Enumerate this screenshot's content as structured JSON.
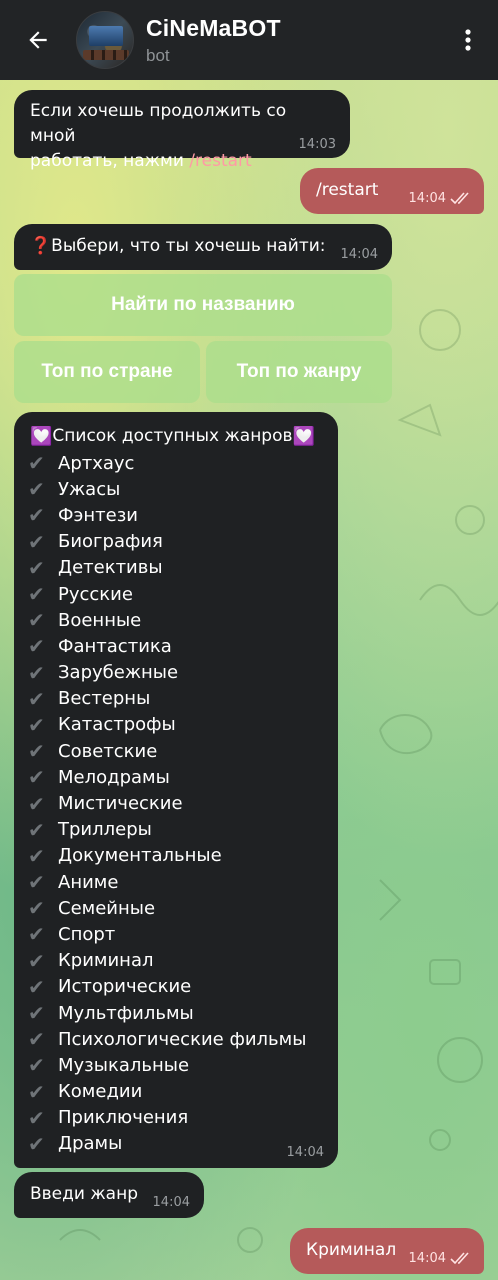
{
  "header": {
    "title": "CiNeMaBOT",
    "subtitle": "bot"
  },
  "messages": {
    "m1": {
      "text_part1": "Если хочешь продолжить со мной",
      "text_part2": "работать, нажми ",
      "command": "/restart",
      "time": "14:03"
    },
    "m2": {
      "text": "/restart",
      "time": "14:04"
    },
    "m3": {
      "icon": "❓",
      "text": "Выбери, что ты хочешь найти:",
      "time": "14:04"
    },
    "m4": {
      "heart": "💟",
      "title": "Список доступных жанров",
      "check": "✔",
      "genres": [
        "Артхаус",
        "Ужасы",
        "Фэнтези",
        "Биография",
        "Детективы",
        "Русские",
        "Военные",
        "Фантастика",
        "Зарубежные",
        "Вестерны",
        "Катастрофы",
        "Советские",
        "Мелодрамы",
        "Мистические",
        "Триллеры",
        "Документальные",
        "Аниме",
        "Семейные",
        "Спорт",
        "Криминал",
        "Исторические",
        "Мультфильмы",
        "Психологические фильмы",
        "Музыкальные",
        "Комедии",
        "Приключения",
        "Драмы"
      ],
      "time": "14:04"
    },
    "m5": {
      "text": "Введи жанр",
      "time": "14:04"
    },
    "m6": {
      "text": "Криминал",
      "time": "14:04"
    }
  },
  "keyboard": {
    "by_name": "Найти по названию",
    "by_country": "Топ по стране",
    "by_genre": "Топ по жанру"
  },
  "colors": {
    "header_bg": "#222426",
    "incoming_bubble": "#1f2123",
    "outgoing_bubble": "#b55a5a",
    "keyboard_button": "#aade8c"
  }
}
